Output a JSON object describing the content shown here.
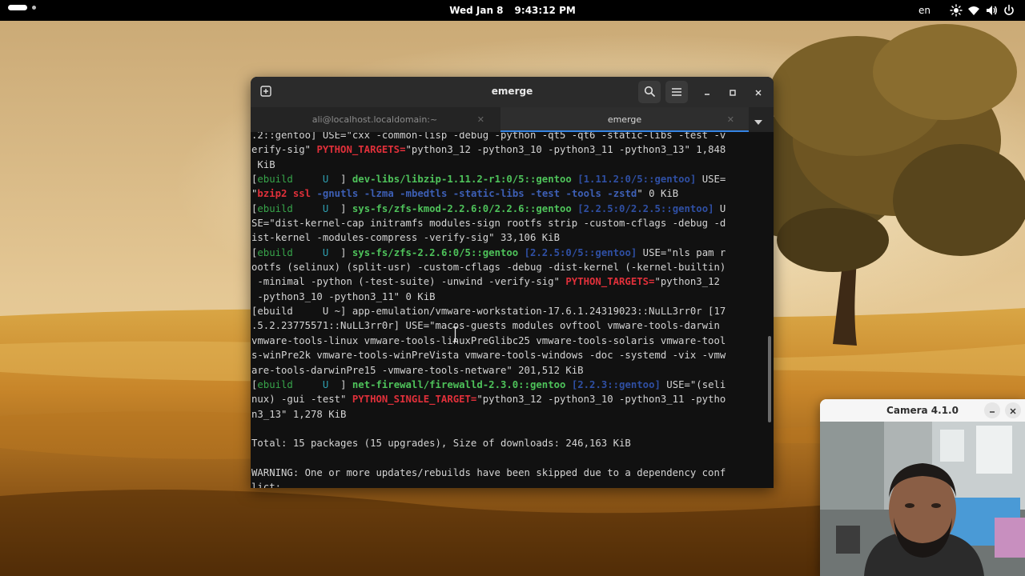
{
  "topbar": {
    "date": "Wed Jan 8",
    "time": "9:43:12 PM",
    "language": "en",
    "tray_icons": [
      "brightness-icon",
      "wifi-icon",
      "volume-icon",
      "power-icon"
    ]
  },
  "terminal": {
    "title": "emerge",
    "tabs": [
      {
        "label": "ali@localhost.localdomain:~",
        "active": false
      },
      {
        "label": "emerge",
        "active": true
      }
    ],
    "accent_color": "#3584e4",
    "lines": [
      {
        "t": ".2::gentoo] USE=\"cxx -common-lisp -debug -python -qt5 -qt6 -static-libs -test -v"
      },
      {
        "t": "erify-sig\" PYTHON_TARGETS=\"python3_12 -python3_10 -python3_11 -python3_13\" 1,848"
      },
      {
        "t": " KiB"
      },
      {
        "t": "[ebuild     U  ] dev-libs/libzip-1.11.2-r1:0/5::gentoo [1.11.2:0/5::gentoo] USE="
      },
      {
        "t": "\"bzip2 ssl -gnutls -lzma -mbedtls -static-libs -test -tools -zstd\" 0 KiB"
      },
      {
        "t": "[ebuild     U  ] sys-fs/zfs-kmod-2.2.6:0/2.2.6::gentoo [2.2.5:0/2.2.5::gentoo] U"
      },
      {
        "t": "SE=\"dist-kernel-cap initramfs modules-sign rootfs strip -custom-cflags -debug -d"
      },
      {
        "t": "ist-kernel -modules-compress -verify-sig\" 33,106 KiB"
      },
      {
        "t": "[ebuild     U  ] sys-fs/zfs-2.2.6:0/5::gentoo [2.2.5:0/5::gentoo] USE=\"nls pam r"
      },
      {
        "t": "ootfs (selinux) (split-usr) -custom-cflags -debug -dist-kernel (-kernel-builtin)"
      },
      {
        "t": " -minimal -python (-test-suite) -unwind -verify-sig\" PYTHON_TARGETS=\"python3_12"
      },
      {
        "t": " -python3_10 -python3_11\" 0 KiB"
      },
      {
        "t": "[ebuild     U ~] app-emulation/vmware-workstation-17.6.1.24319023::NuLL3rr0r [17"
      },
      {
        "t": ".5.2.23775571::NuLL3rr0r] USE=\"macos-guests modules ovftool vmware-tools-darwin"
      },
      {
        "t": "vmware-tools-linux vmware-tools-linuxPreGlibc25 vmware-tools-solaris vmware-tool"
      },
      {
        "t": "s-winPre2k vmware-tools-winPreVista vmware-tools-windows -doc -systemd -vix -vmw"
      },
      {
        "t": "are-tools-darwinPre15 -vmware-tools-netware\" 201,512 KiB"
      },
      {
        "t": "[ebuild     U  ] net-firewall/firewalld-2.3.0::gentoo [2.2.3::gentoo] USE=\"(seli"
      },
      {
        "t": "nux) -gui -test\" PYTHON_SINGLE_TARGET=\"python3_12 -python3_10 -python3_11 -pytho"
      },
      {
        "t": "n3_13\" 1,278 KiB"
      },
      {
        "t": ""
      },
      {
        "t": "Total: 15 packages (15 upgrades), Size of downloads: 246,163 KiB"
      },
      {
        "t": ""
      },
      {
        "t": "WARNING: One or more updates/rebuilds have been skipped due to a dependency conf"
      },
      {
        "t": "lict:"
      }
    ]
  },
  "camera": {
    "title": "Camera 4.1.0"
  }
}
